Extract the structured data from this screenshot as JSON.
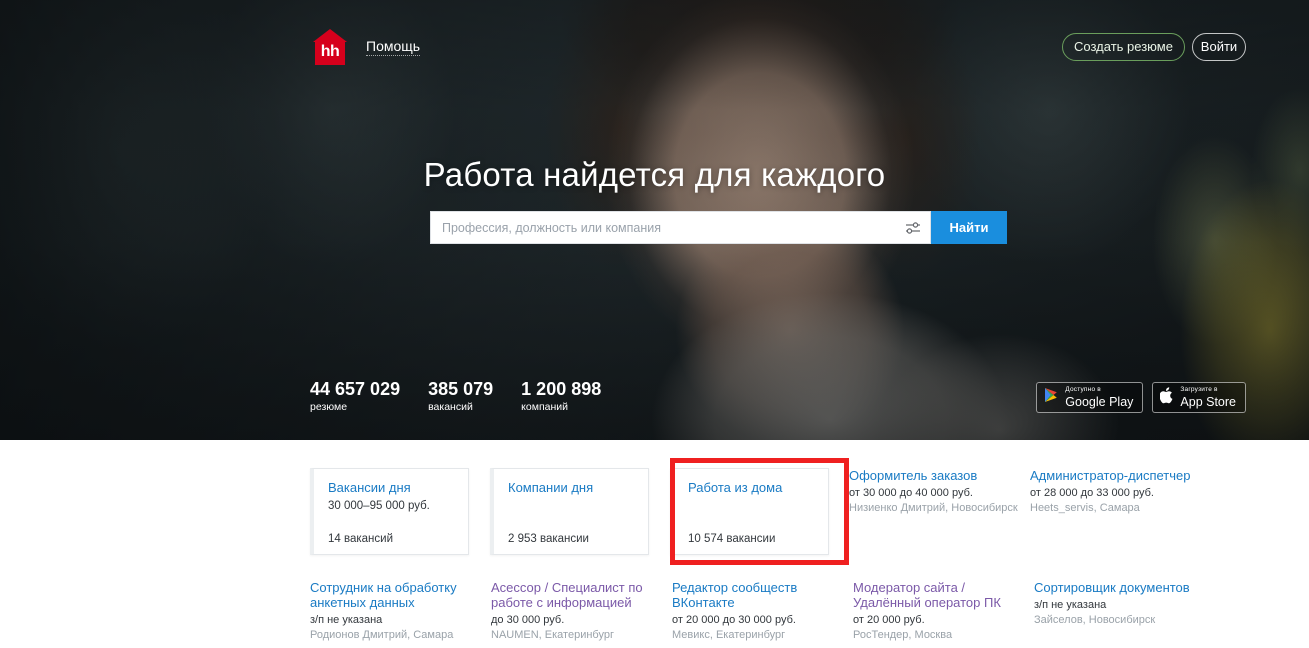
{
  "header": {
    "logo_text": "hh",
    "logo_name": "hh-logo",
    "help_label": "Помощь",
    "create_resume_label": "Создать резюме",
    "login_label": "Войти",
    "create_resume_border_color": "#6a9e5c"
  },
  "hero": {
    "title": "Работа найдется для каждого",
    "search": {
      "placeholder": "Профессия, должность или компания",
      "value": "",
      "filter_icon": "sliders-icon",
      "button_label": "Найти",
      "button_color": "#1a8ede"
    },
    "stats": [
      {
        "number": "44 657 029",
        "label": "резюме"
      },
      {
        "number": "385 079",
        "label": "вакансий"
      },
      {
        "number": "1 200 898",
        "label": "компаний"
      }
    ],
    "stores": [
      {
        "icon": "google-play-icon",
        "top": "Доступно в",
        "bottom": "Google Play"
      },
      {
        "icon": "apple-icon",
        "top": "Загрузите в",
        "bottom": "App Store"
      }
    ]
  },
  "cards": [
    {
      "title": "Вакансии дня",
      "subtitle": "30 000–95 000 руб.",
      "footer": "14 вакансий",
      "highlighted": false
    },
    {
      "title": "Компании дня",
      "subtitle": "",
      "footer": "2 953 вакансии",
      "highlighted": false
    },
    {
      "title": "Работа из дома",
      "subtitle": "",
      "footer": "10 574 вакансии",
      "highlighted": true
    }
  ],
  "highlight_color": "#ef2020",
  "vacancies_top": [
    {
      "title": "Оформитель заказов",
      "pay": "от 30 000 до 40 000 руб.",
      "employer": "Низиенко Дмитрий, Новосибирск",
      "visited": false
    },
    {
      "title": "Администратор-диспетчер",
      "pay": "от 28 000 до 33 000 руб.",
      "employer": "Heets_servis, Самара",
      "visited": false
    }
  ],
  "vacancies_bottom": [
    {
      "title": "Сотрудник на обработку анкетных данных",
      "pay": "з/п не указана",
      "employer": "Родионов Дмитрий, Самара",
      "visited": false
    },
    {
      "title": "Асессор / Специалист по работе с информацией",
      "pay": "до 30 000 руб.",
      "employer": "NAUMEN, Екатеринбург",
      "visited": true
    },
    {
      "title": "Редактор сообществ ВКонтакте",
      "pay": "от 20 000 до 30 000 руб.",
      "employer": "Мевикс, Екатеринбург",
      "visited": false
    },
    {
      "title": "Модератор сайта / Удалённый оператор ПК",
      "pay": "от 20 000 руб.",
      "employer": "РосТендер, Москва",
      "visited": true
    },
    {
      "title": "Сортировщик документов",
      "pay": "з/п не указана",
      "employer": "Зайселов, Новосибирск",
      "visited": false
    }
  ]
}
